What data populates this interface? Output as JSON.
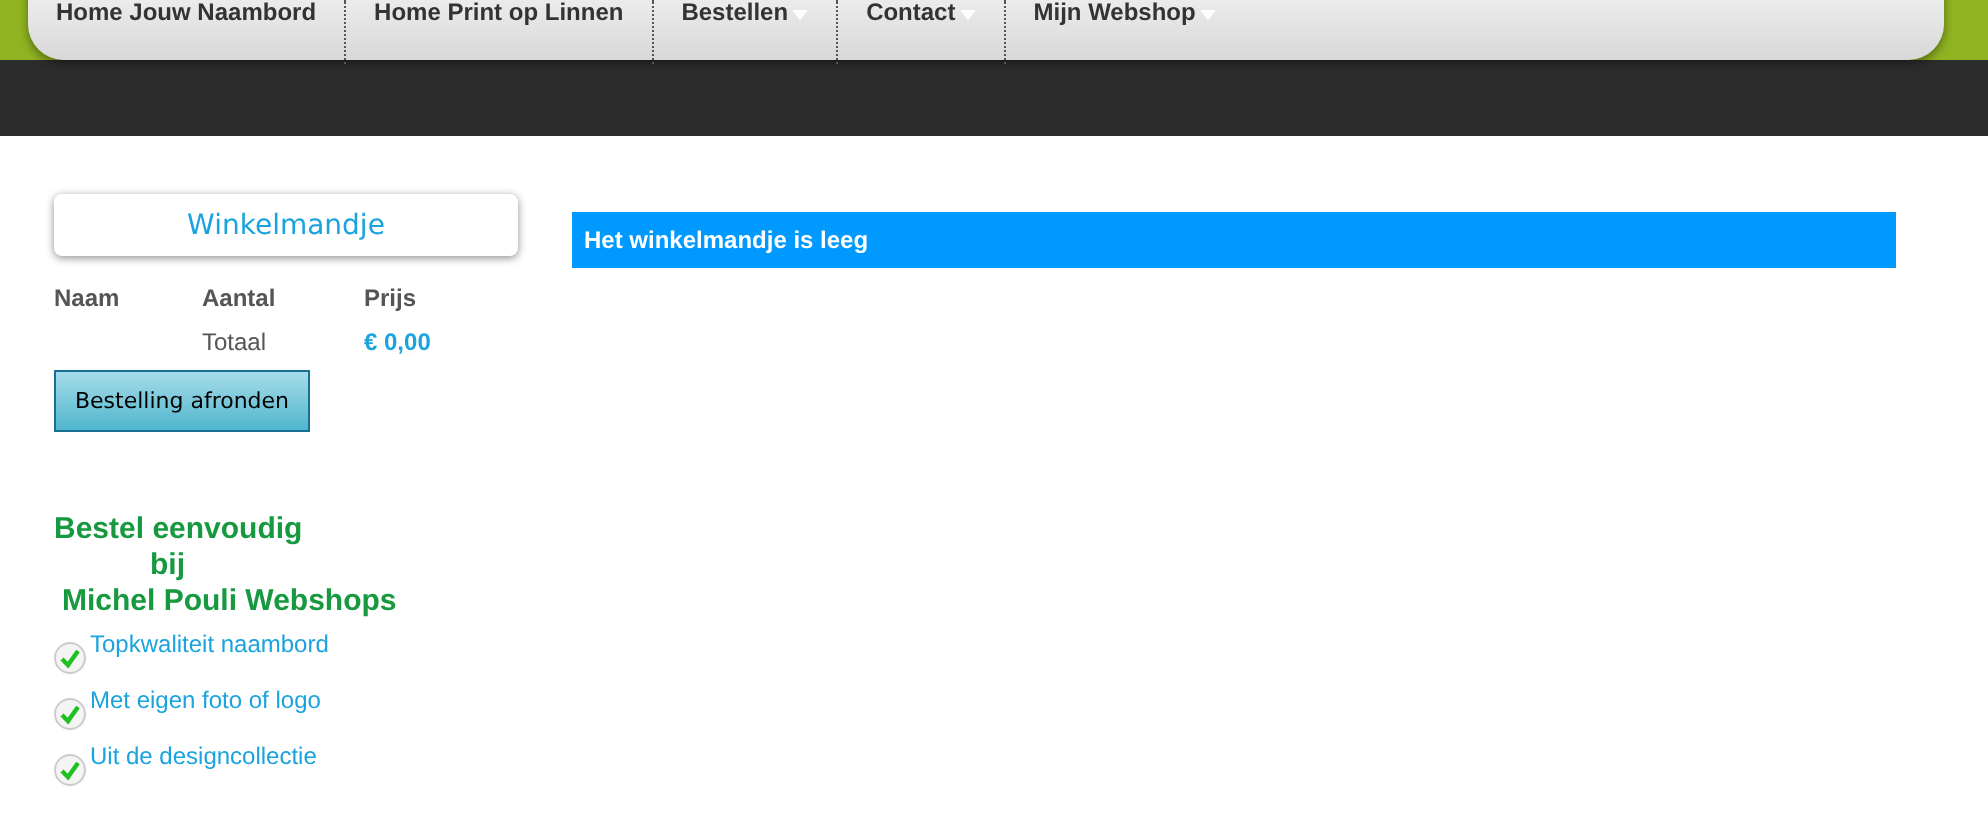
{
  "nav": {
    "items": [
      {
        "label": "Home Jouw Naambord",
        "has_submenu": false
      },
      {
        "label": "Home Print op Linnen",
        "has_submenu": false
      },
      {
        "label": "Bestellen",
        "has_submenu": true
      },
      {
        "label": "Contact",
        "has_submenu": true
      },
      {
        "label": "Mijn Webshop",
        "has_submenu": true
      }
    ]
  },
  "cart": {
    "title": "Winkelmandje",
    "columns": [
      "Naam",
      "Aantal",
      "Prijs"
    ],
    "total_label": "Totaal",
    "total_value": "€ 0,00",
    "button": "Bestelling afronden"
  },
  "promo": {
    "heading_lines": [
      "Bestel eenvoudig",
      "bij",
      "Michel Pouli Webshops"
    ],
    "items": [
      "Topkwaliteit naambord",
      "Met eigen foto of logo",
      "Uit de designcollectie"
    ]
  },
  "message": "Het winkelmandje is leeg"
}
